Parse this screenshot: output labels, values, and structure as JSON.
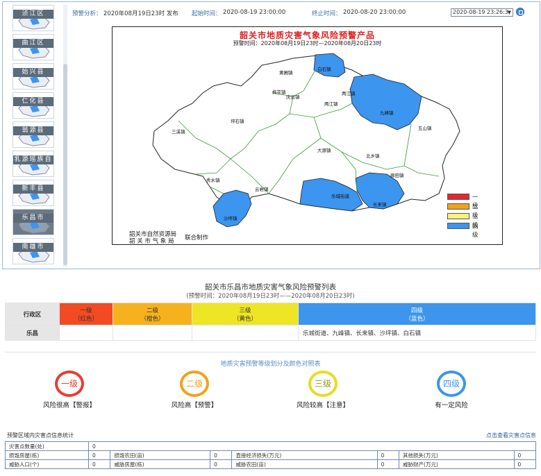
{
  "thumbnails": [
    {
      "label": "浈江区",
      "selected": false
    },
    {
      "label": "曲江区",
      "selected": false
    },
    {
      "label": "始兴县",
      "selected": false
    },
    {
      "label": "仁化县",
      "selected": false
    },
    {
      "label": "翁源县",
      "selected": false
    },
    {
      "label": "乳源瑶族自",
      "selected": false
    },
    {
      "label": "新丰县",
      "selected": false
    },
    {
      "label": "乐昌市",
      "selected": true
    },
    {
      "label": "南雄市",
      "selected": false
    }
  ],
  "info": {
    "forecast_label": "预警分析：",
    "forecast_value": "2020年08月19日23时 发布",
    "start_label": "起始时间：",
    "start_value": "2020-08-19 23:00:00",
    "end_label": "终止时间：",
    "end_value": "2020-08-20 23:00:00",
    "date_select": "2020-08-19 23:26:3"
  },
  "map": {
    "title": "韶关市地质灾害气象风险预警产品",
    "subtitle": "预警时间：2020年08月19日23时—2020年08月20日23时",
    "credit_line1": "韶关市自然资源局",
    "credit_line2": "韶 关 市 气 象 局",
    "credit_joint": "联合制作",
    "towns": [
      "黄圃镇",
      "白石镇",
      "两江镇",
      "梅花镇",
      "庆云镇",
      "坪石镇",
      "九峰镇",
      "五山镇",
      "三溪镇",
      "大源镇",
      "北乡镇",
      "秀水镇",
      "廊田镇",
      "云岩镇",
      "乐城街道",
      "长来镇",
      "沙坪镇",
      "两江镇"
    ],
    "legend": [
      {
        "label": "一级",
        "color": "#e8262d"
      },
      {
        "label": "二级",
        "color": "#f2a11a"
      },
      {
        "label": "三级",
        "color": "#fbf27a"
      },
      {
        "label": "四级",
        "color": "#3c95ee"
      }
    ]
  },
  "list": {
    "title": "韶关市乐昌市地质灾害气象风险预警列表",
    "subtitle": "(预警时间：2020年08月19日23时——2020年08月20日23时)",
    "header_region": "行政区",
    "levels": [
      {
        "name": "一级",
        "color_name": "（红色）",
        "bg": "#f24a22"
      },
      {
        "name": "二级",
        "color_name": "（橙色）",
        "bg": "#f6b21c"
      },
      {
        "name": "三级",
        "color_name": "（黄色）",
        "bg": "#eee525"
      },
      {
        "name": "四级",
        "color_name": "（蓝色）",
        "bg": "#3d95ec"
      }
    ],
    "row_region": "乐昌",
    "row_level4": "乐城街道、九峰镇、长来镇、沙坪镇、白石镇"
  },
  "scale": {
    "title": "地质灾害预警等级划分及颜色对照表",
    "items": [
      {
        "name": "一级",
        "desc": "风险很高【警报】",
        "ring": "#ea3b32",
        "text": "#ea3b32"
      },
      {
        "name": "二级",
        "desc": "风险高【预警】",
        "ring": "#f2a11a",
        "text": "#f2a11a"
      },
      {
        "name": "三级",
        "desc": "风险较高【注意】",
        "ring": "#e6dd1f",
        "text": "#9a9210"
      },
      {
        "name": "四级",
        "desc": "有一定风险",
        "ring": "#3d95ec",
        "text": "#3d95ec"
      }
    ]
  },
  "stats": {
    "title": "预警区域内灾害点信息统计",
    "link": "点击查看灾害点信息",
    "row1": {
      "label": "灾害点数量(处)",
      "value": "0"
    },
    "row2": [
      {
        "label": "损毁房屋(栋)",
        "value": "0"
      },
      {
        "label": "损毁农田(亩)",
        "value": "0"
      },
      {
        "label": "直接经济损失(万元)",
        "value": "0"
      },
      {
        "label": "其他损失(万元)",
        "value": "0"
      }
    ],
    "row3": [
      {
        "label": "威胁人口(个)",
        "value": "0"
      },
      {
        "label": "威胁房屋(栋)",
        "value": "0"
      },
      {
        "label": "威胁农田(亩)",
        "value": "0"
      },
      {
        "label": "威胁财产(万元)",
        "value": "0"
      }
    ]
  }
}
